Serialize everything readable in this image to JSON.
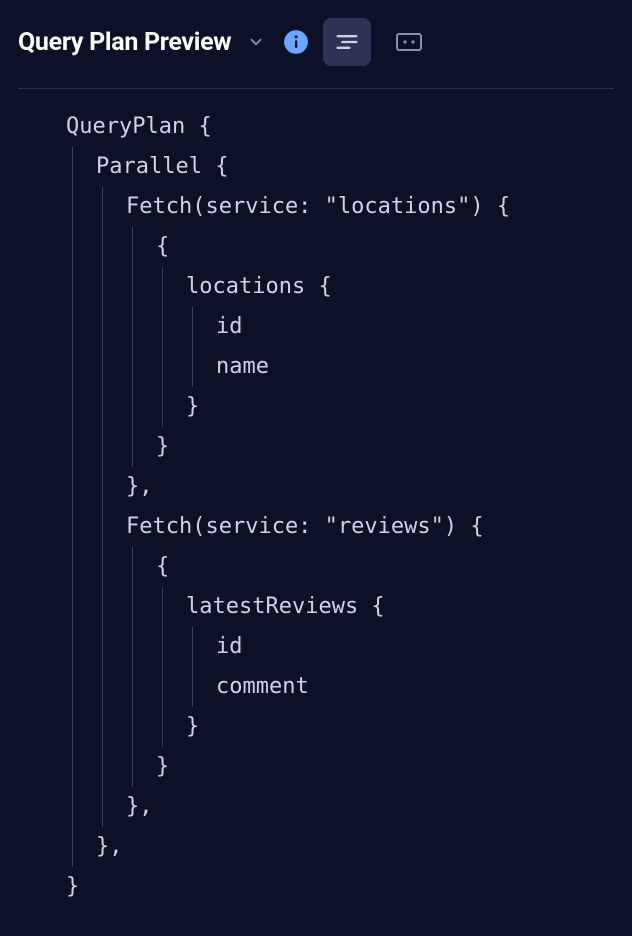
{
  "header": {
    "title": "Query Plan Preview"
  },
  "code": {
    "lines": [
      {
        "indent": 0,
        "guides": [],
        "text": "QueryPlan {"
      },
      {
        "indent": 1,
        "guides": [
          0
        ],
        "text": "Parallel {"
      },
      {
        "indent": 2,
        "guides": [
          0,
          1
        ],
        "text": "Fetch(service: \"locations\") {"
      },
      {
        "indent": 3,
        "guides": [
          0,
          1,
          2
        ],
        "text": "{"
      },
      {
        "indent": 4,
        "guides": [
          0,
          1,
          2,
          3
        ],
        "text": "locations {"
      },
      {
        "indent": 5,
        "guides": [
          0,
          1,
          2,
          3,
          4
        ],
        "text": "id"
      },
      {
        "indent": 5,
        "guides": [
          0,
          1,
          2,
          3,
          4
        ],
        "text": "name"
      },
      {
        "indent": 4,
        "guides": [
          0,
          1,
          2,
          3
        ],
        "text": "}"
      },
      {
        "indent": 3,
        "guides": [
          0,
          1,
          2
        ],
        "text": "}"
      },
      {
        "indent": 2,
        "guides": [
          0,
          1
        ],
        "text": "},"
      },
      {
        "indent": 2,
        "guides": [
          0,
          1
        ],
        "text": "Fetch(service: \"reviews\") {"
      },
      {
        "indent": 3,
        "guides": [
          0,
          1,
          2
        ],
        "text": "{"
      },
      {
        "indent": 4,
        "guides": [
          0,
          1,
          2,
          3
        ],
        "text": "latestReviews {"
      },
      {
        "indent": 5,
        "guides": [
          0,
          1,
          2,
          3,
          4
        ],
        "text": "id"
      },
      {
        "indent": 5,
        "guides": [
          0,
          1,
          2,
          3,
          4
        ],
        "text": "comment"
      },
      {
        "indent": 4,
        "guides": [
          0,
          1,
          2,
          3
        ],
        "text": "}"
      },
      {
        "indent": 3,
        "guides": [
          0,
          1,
          2
        ],
        "text": "}"
      },
      {
        "indent": 2,
        "guides": [
          0,
          1
        ],
        "text": "},"
      },
      {
        "indent": 1,
        "guides": [
          0
        ],
        "text": "},"
      },
      {
        "indent": 0,
        "guides": [],
        "text": "}"
      }
    ],
    "indentUnit": 30,
    "guideOffsets": [
      6,
      36,
      66,
      96,
      126
    ]
  }
}
